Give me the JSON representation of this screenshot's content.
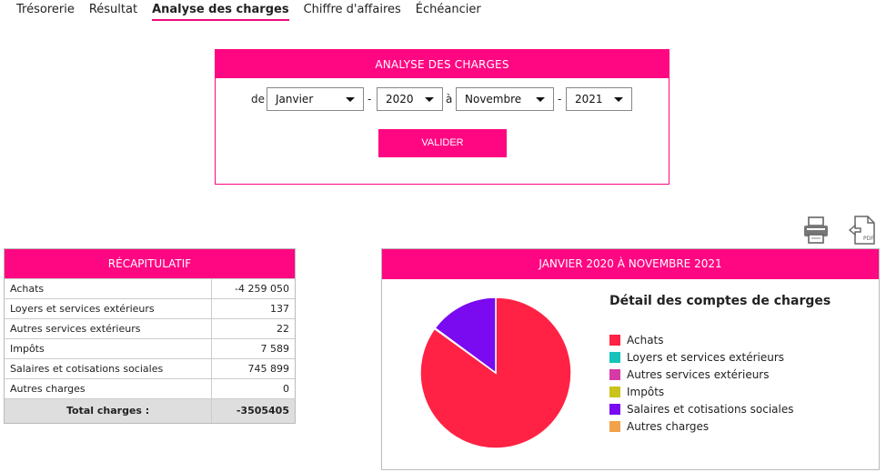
{
  "nav": {
    "items": [
      "Trésorerie",
      "Résultat",
      "Analyse des charges",
      "Chiffre d'affaires",
      "Échéancier"
    ],
    "active": "Analyse des charges"
  },
  "filter": {
    "title": "ANALYSE DES CHARGES",
    "de_label": "de",
    "dash": "-",
    "a_label": "à",
    "from_month": "Janvier",
    "from_year": "2020",
    "to_month": "Novembre",
    "to_year": "2021",
    "submit_label": "VALIDER"
  },
  "icons": {
    "print": "printer-icon",
    "pdf": "pdf-export-icon",
    "pdf_text": "PDF"
  },
  "recap": {
    "title": "RÉCAPITULATIF",
    "rows": [
      {
        "label": "Achats",
        "value": "-4 259 050"
      },
      {
        "label": "Loyers et services extérieurs",
        "value": "137"
      },
      {
        "label": "Autres services extérieurs",
        "value": "22"
      },
      {
        "label": "Impôts",
        "value": "7 589"
      },
      {
        "label": "Salaires et cotisations sociales",
        "value": "745 899"
      },
      {
        "label": "Autres charges",
        "value": "0"
      }
    ],
    "total_label": "Total charges :",
    "total_value": "-3505405"
  },
  "chart": {
    "header": "JANVIER 2020 À NOVEMBRE 2021",
    "legend_title": "Détail des comptes de charges"
  },
  "chart_data": {
    "type": "pie",
    "title": "Détail des comptes de charges",
    "categories": [
      "Achats",
      "Loyers et services extérieurs",
      "Autres services extérieurs",
      "Impôts",
      "Salaires et cotisations sociales",
      "Autres charges"
    ],
    "values": [
      4259050,
      137,
      22,
      7589,
      745899,
      0
    ],
    "colors": [
      "#ff2244",
      "#16c3bb",
      "#d63aa6",
      "#c8c41a",
      "#7a0aef",
      "#f2a24a"
    ],
    "legend_position": "right"
  }
}
